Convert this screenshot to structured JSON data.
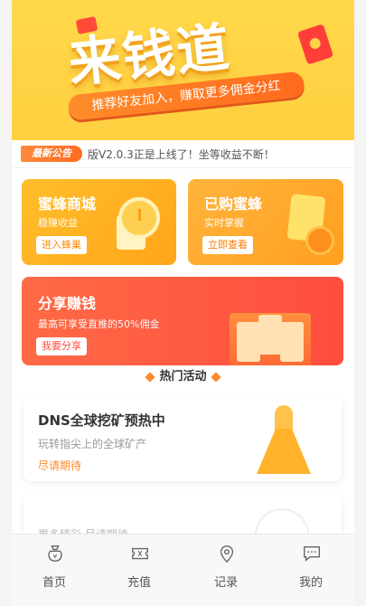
{
  "banner": {
    "title": "来钱道",
    "subtitle": "推荐好友加入，赚取更多佣金分红"
  },
  "notice": {
    "tag": "最新公告",
    "text": "版V2.0.3正是上线了！坐等收益不断！"
  },
  "cards": {
    "mall": {
      "title": "蜜蜂商城",
      "desc": "稳赚收益",
      "button": "进入蜂巢"
    },
    "bought": {
      "title": "已购蜜蜂",
      "desc": "实时掌握",
      "button": "立即查看"
    },
    "share": {
      "title": "分享赚钱",
      "desc": "最高可享受直推的50%佣金",
      "button": "我要分享"
    }
  },
  "hot_section": {
    "title": "热门活动"
  },
  "activities": [
    {
      "title": "DNS全球挖矿预热中",
      "desc": "玩转指尖上的全球矿产",
      "status": "尽请期待"
    },
    {
      "title": "",
      "desc": "更多精彩 尽请期待"
    }
  ],
  "tabbar": {
    "items": [
      {
        "label": "首页",
        "icon": "money-bag-icon"
      },
      {
        "label": "充值",
        "icon": "ticket-icon"
      },
      {
        "label": "记录",
        "icon": "location-pin-icon"
      },
      {
        "label": "我的",
        "icon": "chat-bubble-icon"
      }
    ]
  },
  "colors": {
    "banner_yellow": "#ffd94a",
    "accent_orange": "#ff8a2b",
    "share_red": "#ff4d3f"
  }
}
